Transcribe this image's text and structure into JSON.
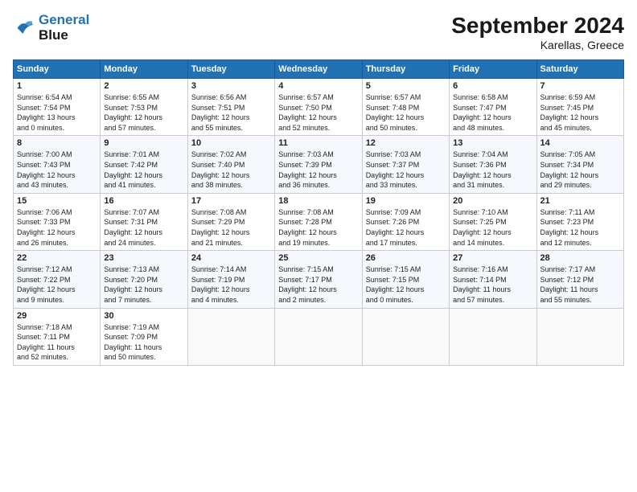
{
  "logo": {
    "line1": "General",
    "line2": "Blue"
  },
  "title": "September 2024",
  "subtitle": "Karellas, Greece",
  "days_of_week": [
    "Sunday",
    "Monday",
    "Tuesday",
    "Wednesday",
    "Thursday",
    "Friday",
    "Saturday"
  ],
  "weeks": [
    [
      {
        "day": "1",
        "sunrise": "6:54 AM",
        "sunset": "7:54 PM",
        "daylight": "13 hours and 0 minutes."
      },
      {
        "day": "2",
        "sunrise": "6:55 AM",
        "sunset": "7:53 PM",
        "daylight": "12 hours and 57 minutes."
      },
      {
        "day": "3",
        "sunrise": "6:56 AM",
        "sunset": "7:51 PM",
        "daylight": "12 hours and 55 minutes."
      },
      {
        "day": "4",
        "sunrise": "6:57 AM",
        "sunset": "7:50 PM",
        "daylight": "12 hours and 52 minutes."
      },
      {
        "day": "5",
        "sunrise": "6:57 AM",
        "sunset": "7:48 PM",
        "daylight": "12 hours and 50 minutes."
      },
      {
        "day": "6",
        "sunrise": "6:58 AM",
        "sunset": "7:47 PM",
        "daylight": "12 hours and 48 minutes."
      },
      {
        "day": "7",
        "sunrise": "6:59 AM",
        "sunset": "7:45 PM",
        "daylight": "12 hours and 45 minutes."
      }
    ],
    [
      {
        "day": "8",
        "sunrise": "7:00 AM",
        "sunset": "7:43 PM",
        "daylight": "12 hours and 43 minutes."
      },
      {
        "day": "9",
        "sunrise": "7:01 AM",
        "sunset": "7:42 PM",
        "daylight": "12 hours and 41 minutes."
      },
      {
        "day": "10",
        "sunrise": "7:02 AM",
        "sunset": "7:40 PM",
        "daylight": "12 hours and 38 minutes."
      },
      {
        "day": "11",
        "sunrise": "7:03 AM",
        "sunset": "7:39 PM",
        "daylight": "12 hours and 36 minutes."
      },
      {
        "day": "12",
        "sunrise": "7:03 AM",
        "sunset": "7:37 PM",
        "daylight": "12 hours and 33 minutes."
      },
      {
        "day": "13",
        "sunrise": "7:04 AM",
        "sunset": "7:36 PM",
        "daylight": "12 hours and 31 minutes."
      },
      {
        "day": "14",
        "sunrise": "7:05 AM",
        "sunset": "7:34 PM",
        "daylight": "12 hours and 29 minutes."
      }
    ],
    [
      {
        "day": "15",
        "sunrise": "7:06 AM",
        "sunset": "7:33 PM",
        "daylight": "12 hours and 26 minutes."
      },
      {
        "day": "16",
        "sunrise": "7:07 AM",
        "sunset": "7:31 PM",
        "daylight": "12 hours and 24 minutes."
      },
      {
        "day": "17",
        "sunrise": "7:08 AM",
        "sunset": "7:29 PM",
        "daylight": "12 hours and 21 minutes."
      },
      {
        "day": "18",
        "sunrise": "7:08 AM",
        "sunset": "7:28 PM",
        "daylight": "12 hours and 19 minutes."
      },
      {
        "day": "19",
        "sunrise": "7:09 AM",
        "sunset": "7:26 PM",
        "daylight": "12 hours and 17 minutes."
      },
      {
        "day": "20",
        "sunrise": "7:10 AM",
        "sunset": "7:25 PM",
        "daylight": "12 hours and 14 minutes."
      },
      {
        "day": "21",
        "sunrise": "7:11 AM",
        "sunset": "7:23 PM",
        "daylight": "12 hours and 12 minutes."
      }
    ],
    [
      {
        "day": "22",
        "sunrise": "7:12 AM",
        "sunset": "7:22 PM",
        "daylight": "12 hours and 9 minutes."
      },
      {
        "day": "23",
        "sunrise": "7:13 AM",
        "sunset": "7:20 PM",
        "daylight": "12 hours and 7 minutes."
      },
      {
        "day": "24",
        "sunrise": "7:14 AM",
        "sunset": "7:19 PM",
        "daylight": "12 hours and 4 minutes."
      },
      {
        "day": "25",
        "sunrise": "7:15 AM",
        "sunset": "7:17 PM",
        "daylight": "12 hours and 2 minutes."
      },
      {
        "day": "26",
        "sunrise": "7:15 AM",
        "sunset": "7:15 PM",
        "daylight": "12 hours and 0 minutes."
      },
      {
        "day": "27",
        "sunrise": "7:16 AM",
        "sunset": "7:14 PM",
        "daylight": "11 hours and 57 minutes."
      },
      {
        "day": "28",
        "sunrise": "7:17 AM",
        "sunset": "7:12 PM",
        "daylight": "11 hours and 55 minutes."
      }
    ],
    [
      {
        "day": "29",
        "sunrise": "7:18 AM",
        "sunset": "7:11 PM",
        "daylight": "11 hours and 52 minutes."
      },
      {
        "day": "30",
        "sunrise": "7:19 AM",
        "sunset": "7:09 PM",
        "daylight": "11 hours and 50 minutes."
      },
      null,
      null,
      null,
      null,
      null
    ]
  ]
}
